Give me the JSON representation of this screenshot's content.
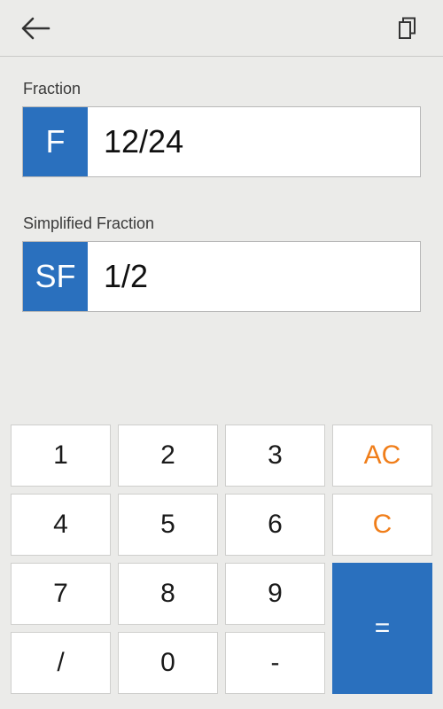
{
  "toolbar": {
    "back_icon": "arrow-left-icon",
    "copy_icon": "copy-icon"
  },
  "fraction": {
    "label": "Fraction",
    "badge": "F",
    "value": "12/24"
  },
  "simplified": {
    "label": "Simplified Fraction",
    "badge": "SF",
    "value": "1/2"
  },
  "keypad": {
    "k1": "1",
    "k2": "2",
    "k3": "3",
    "ac": "AC",
    "k4": "4",
    "k5": "5",
    "k6": "6",
    "c": "C",
    "k7": "7",
    "k8": "8",
    "k9": "9",
    "equals": "=",
    "slash": "/",
    "k0": "0",
    "minus": "-"
  },
  "colors": {
    "accent": "#2a70be",
    "orange": "#f07e1a",
    "background": "#ebebe9"
  }
}
